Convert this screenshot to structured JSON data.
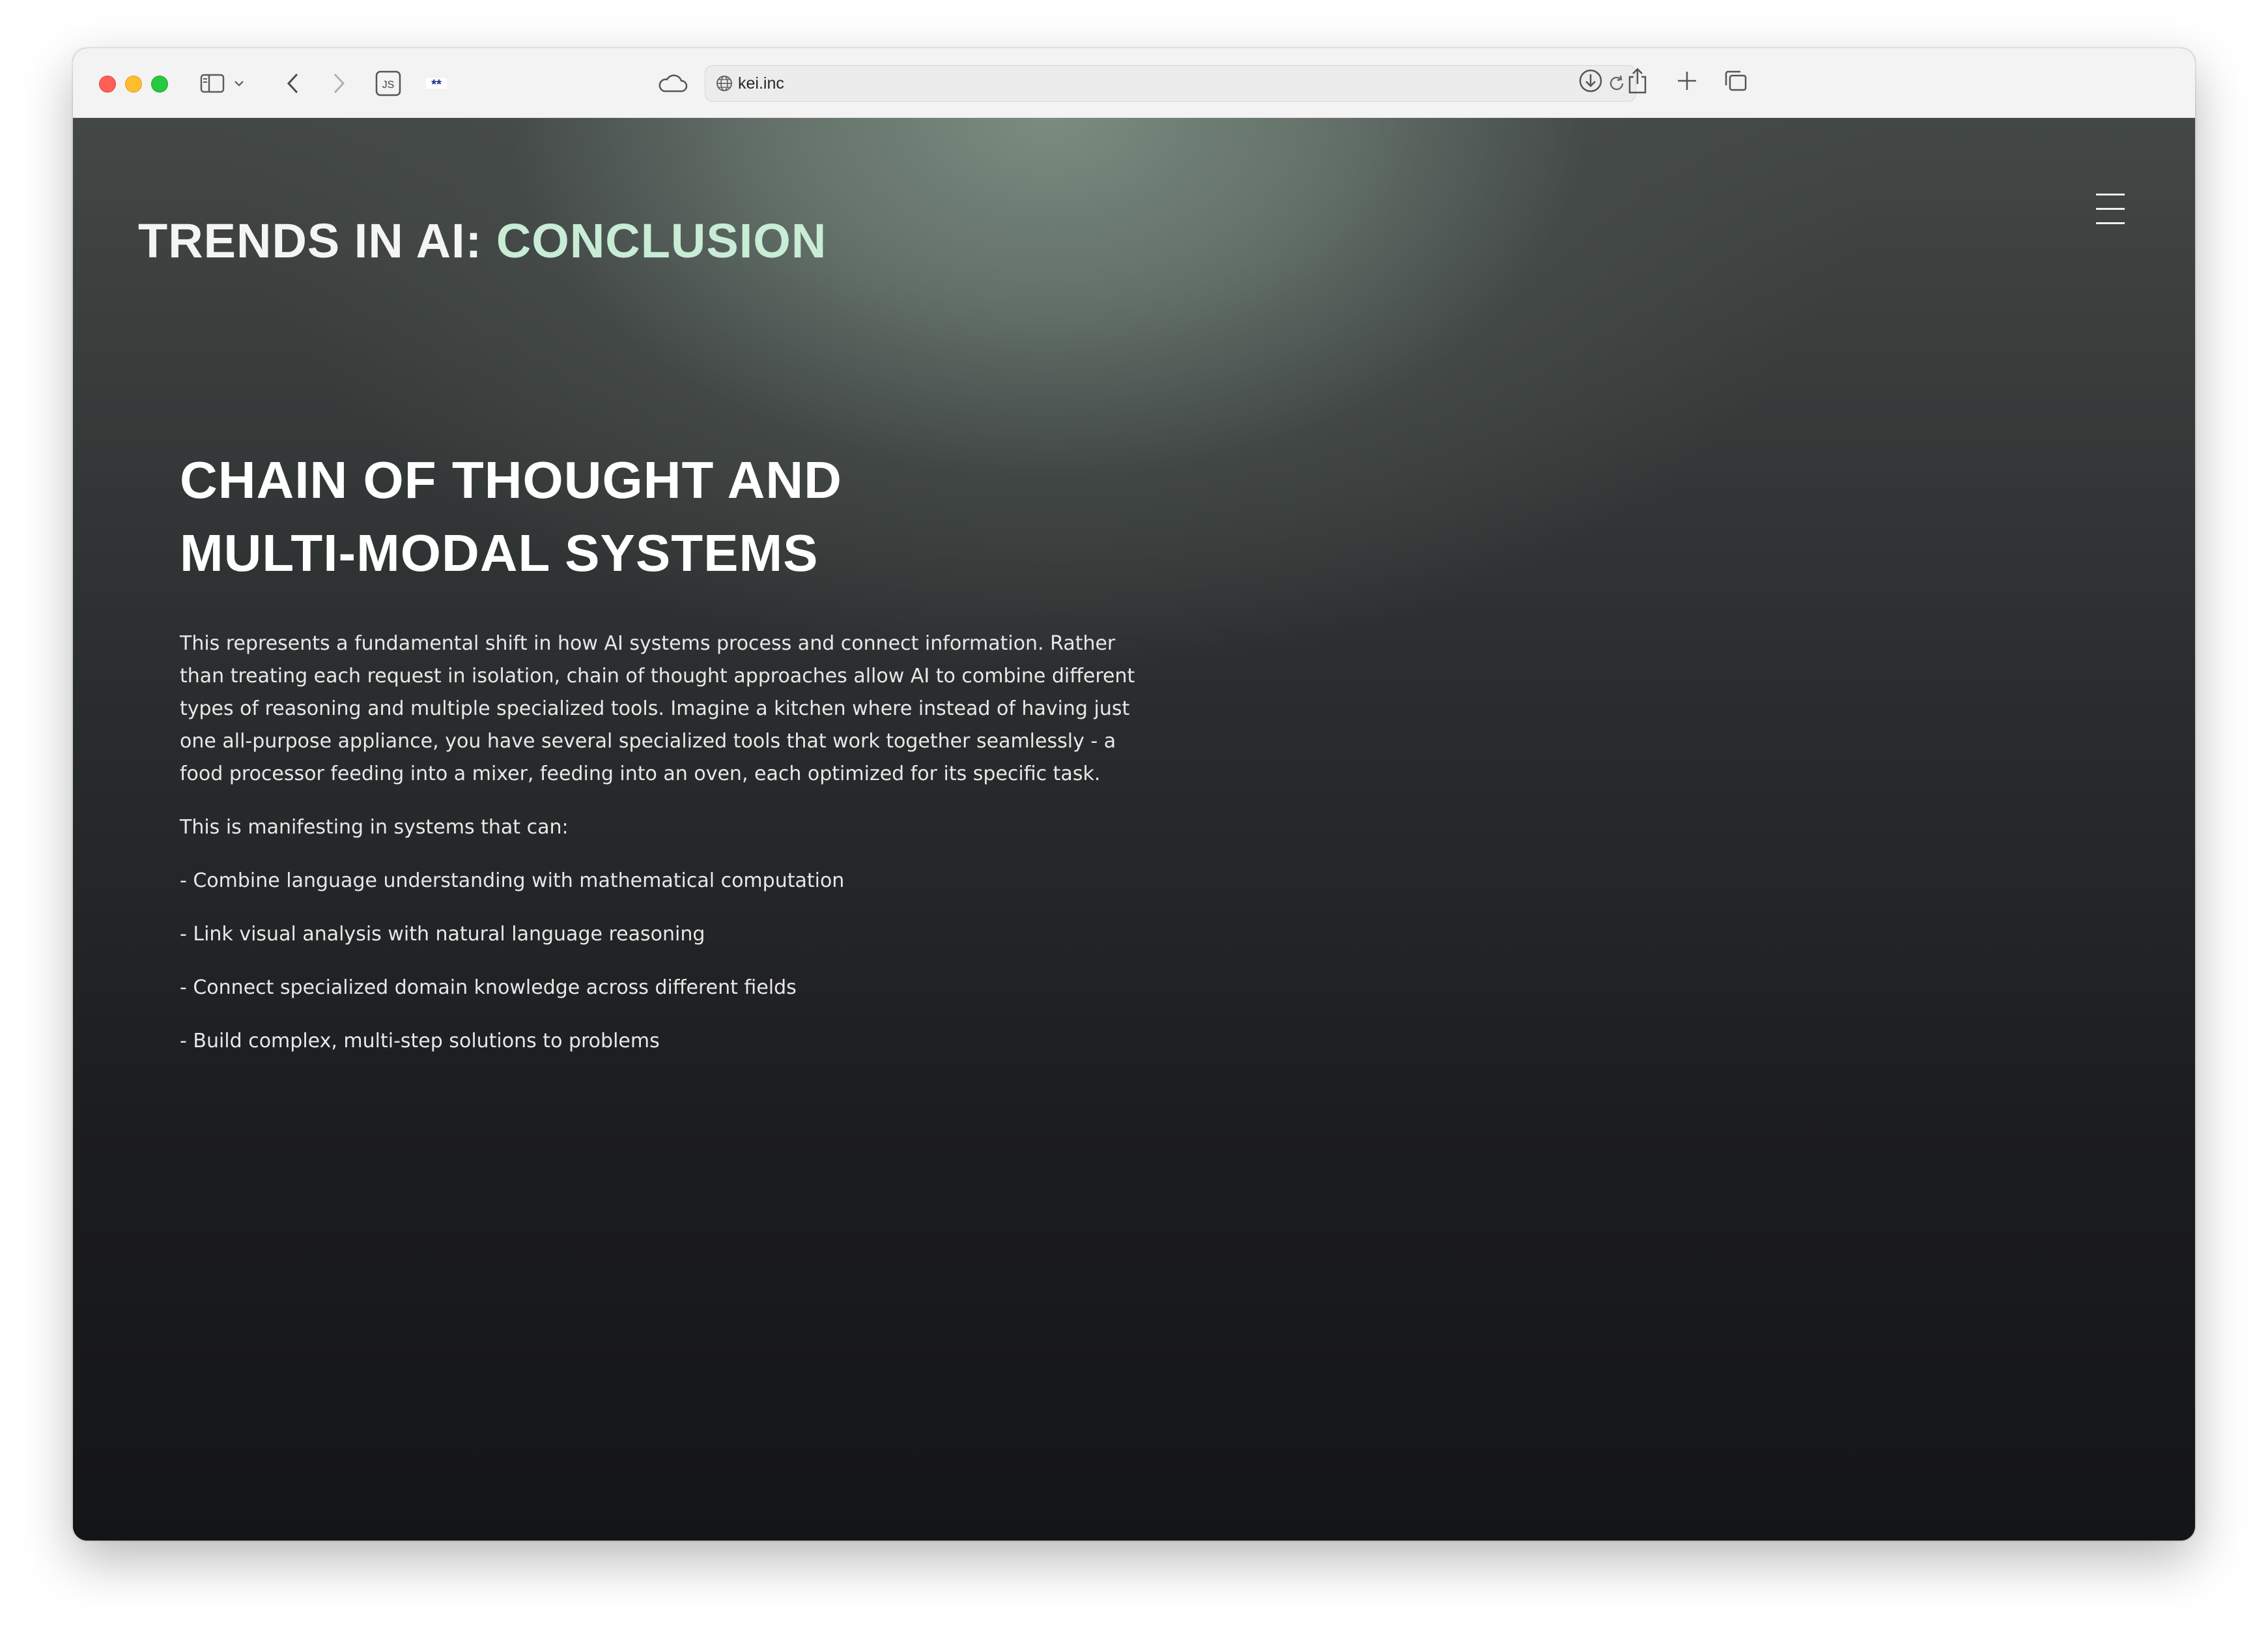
{
  "browser": {
    "url": "kei.inc",
    "extensions": {
      "js_label": "JS",
      "flag_label": "**"
    }
  },
  "page": {
    "title_main": "TRENDS IN AI: ",
    "title_accent": "CONCLUSION",
    "accent_color": "#c8ecd5",
    "section_heading": "CHAIN OF THOUGHT AND MULTI-MODAL SYSTEMS",
    "intro_paragraph": "This represents a fundamental shift in how AI systems process and connect information. Rather than treating each request in isolation, chain of thought approaches allow AI to combine different types of reasoning and multiple specialized tools. Imagine a kitchen where instead of having just one all-purpose appliance, you have several specialized tools that work together seamlessly - a food processor feeding into a mixer, feeding into an oven, each optimized for its specific task.",
    "list_intro": "This is manifesting in systems that can:",
    "bullets": [
      "- Combine language understanding with mathematical computation",
      "- Link visual analysis with natural language reasoning",
      "- Connect specialized domain knowledge across different fields",
      "- Build complex, multi-step solutions to problems"
    ]
  }
}
